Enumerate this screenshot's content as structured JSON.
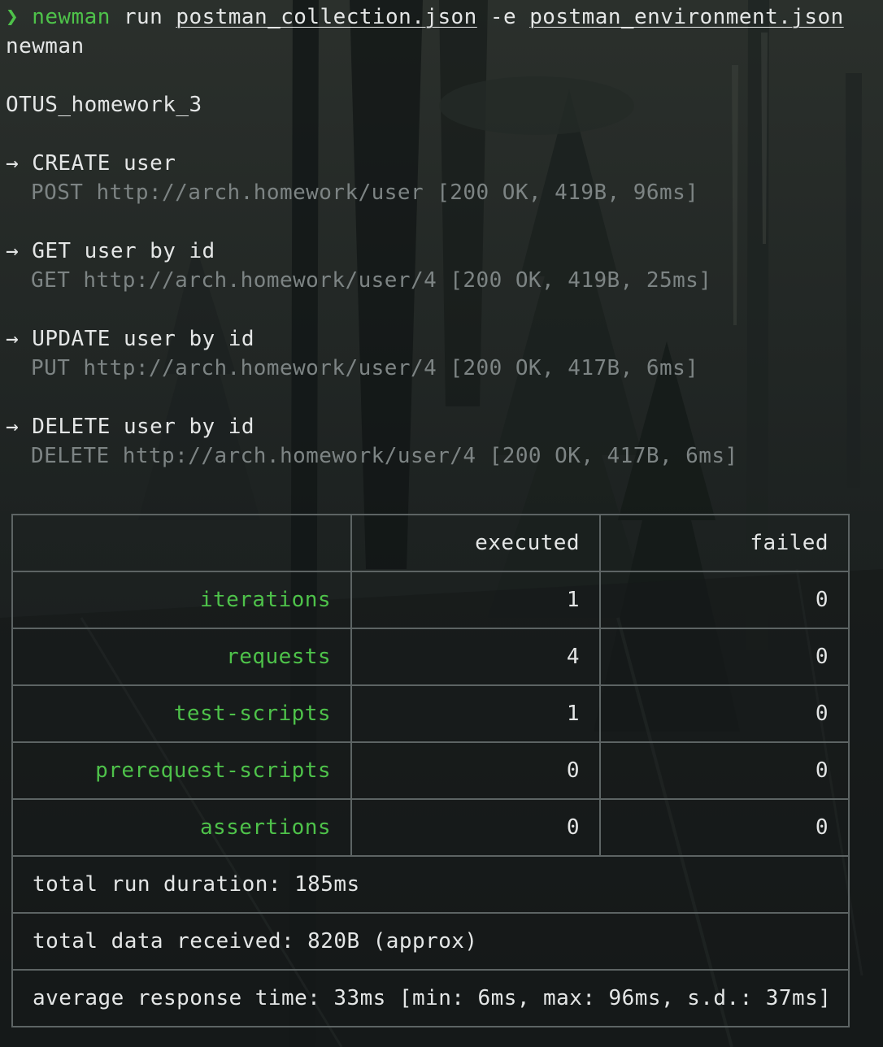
{
  "command": {
    "caret": "❯",
    "program": "newman",
    "subcommand": "run",
    "collection_file": "postman_collection.json",
    "env_flag": "-e",
    "environment_file": "postman_environment.json"
  },
  "tool_name": "newman",
  "collection_name": "OTUS_homework_3",
  "requests": [
    {
      "arrow": "→",
      "name": "CREATE user",
      "detail": "POST http://arch.homework/user [200 OK, 419B, 96ms]"
    },
    {
      "arrow": "→",
      "name": "GET user by id",
      "detail": "GET http://arch.homework/user/4 [200 OK, 419B, 25ms]"
    },
    {
      "arrow": "→",
      "name": "UPDATE user by id",
      "detail": "PUT http://arch.homework/user/4 [200 OK, 417B, 6ms]"
    },
    {
      "arrow": "→",
      "name": "DELETE user by id",
      "detail": "DELETE http://arch.homework/user/4 [200 OK, 417B, 6ms]"
    }
  ],
  "summary": {
    "headers": [
      "",
      "executed",
      "failed"
    ],
    "rows": [
      {
        "metric": "iterations",
        "executed": "1",
        "failed": "0"
      },
      {
        "metric": "requests",
        "executed": "4",
        "failed": "0"
      },
      {
        "metric": "test-scripts",
        "executed": "1",
        "failed": "0"
      },
      {
        "metric": "prerequest-scripts",
        "executed": "0",
        "failed": "0"
      },
      {
        "metric": "assertions",
        "executed": "0",
        "failed": "0"
      }
    ],
    "total_run_duration": "total run duration: 185ms",
    "total_data_received": "total data received: 820B (approx)",
    "average_response_time": "average response time: 33ms [min: 6ms, max: 96ms, s.d.: 37ms]"
  },
  "colors": {
    "background": "#161a1a",
    "text": "#e4e6e6",
    "green": "#4ec24a",
    "dim": "#7d8484",
    "table_border": "#5d6464"
  }
}
